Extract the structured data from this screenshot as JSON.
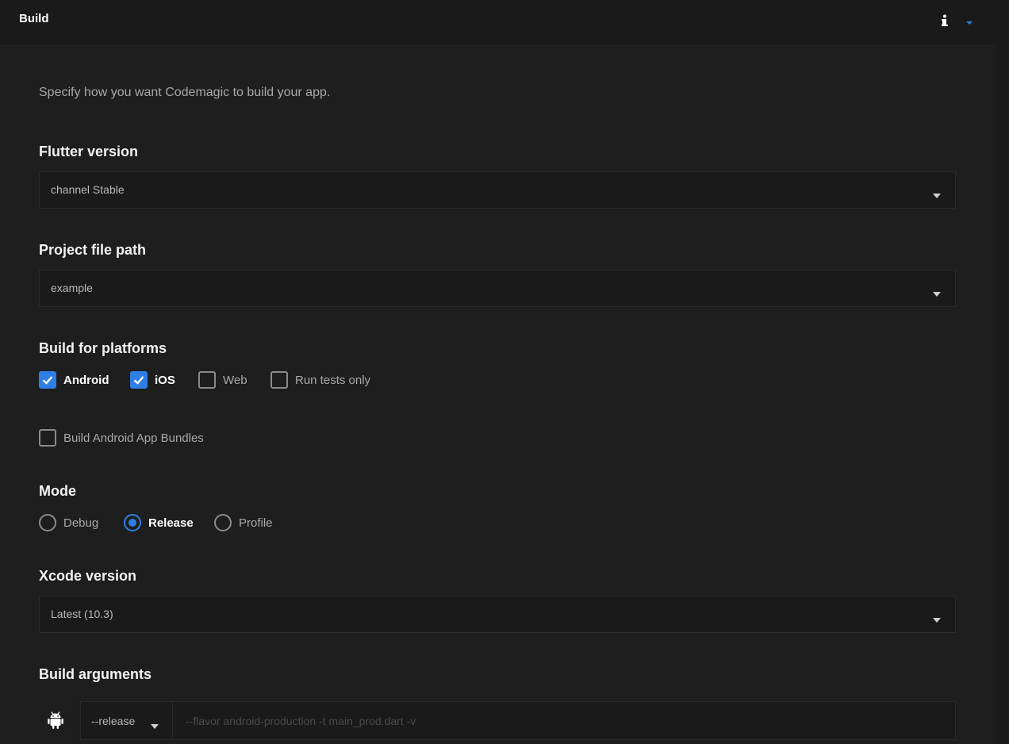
{
  "header": {
    "title": "Build",
    "info_icon": "info-icon",
    "chevron_icon": "chevron-down-icon"
  },
  "intro": "Specify how you want Codemagic to build your app.",
  "flutter_version": {
    "label": "Flutter version",
    "value": "channel Stable"
  },
  "project_file_path": {
    "label": "Project file path",
    "value": "example"
  },
  "platforms": {
    "label": "Build for platforms",
    "options": [
      {
        "label": "Android",
        "checked": true
      },
      {
        "label": "iOS",
        "checked": true
      },
      {
        "label": "Web",
        "checked": false
      },
      {
        "label": "Run tests only",
        "checked": false
      }
    ]
  },
  "app_bundles": {
    "label": "Build Android App Bundles",
    "checked": false
  },
  "mode": {
    "label": "Mode",
    "options": [
      {
        "label": "Debug",
        "selected": false
      },
      {
        "label": "Release",
        "selected": true
      },
      {
        "label": "Profile",
        "selected": false
      }
    ]
  },
  "xcode_version": {
    "label": "Xcode version",
    "value": "Latest (10.3)"
  },
  "build_arguments": {
    "label": "Build arguments",
    "platform_icon": "android-icon",
    "mode_value": "--release",
    "placeholder": "--flavor android-production -t main_prod.dart -v"
  },
  "colors": {
    "accent": "#2f7ee6",
    "background": "#1e1e1e",
    "header_background": "#1a1a1a"
  }
}
